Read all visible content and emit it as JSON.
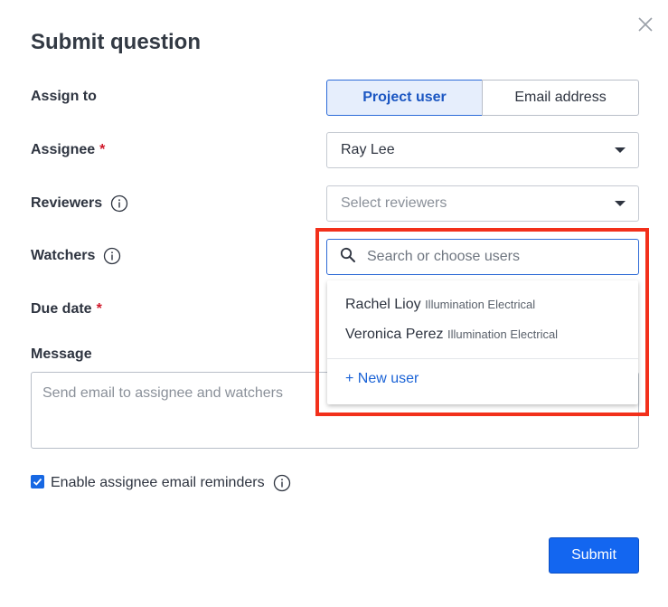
{
  "dialog": {
    "title": "Submit question",
    "close_icon": "close-icon"
  },
  "assign_to": {
    "label": "Assign to",
    "options": [
      "Project user",
      "Email address"
    ],
    "selected": "Project user"
  },
  "assignee": {
    "label": "Assignee",
    "required_mark": "*",
    "value": "Ray Lee"
  },
  "reviewers": {
    "label": "Reviewers",
    "placeholder": "Select reviewers"
  },
  "watchers": {
    "label": "Watchers",
    "search_placeholder": "Search or choose users",
    "options": [
      {
        "name": "Rachel Lioy",
        "company": "Illumination Electrical"
      },
      {
        "name": "Veronica Perez",
        "company": "Illumination Electrical"
      }
    ],
    "new_user_label": "+ New user"
  },
  "due_date": {
    "label": "Due date",
    "required_mark": "*"
  },
  "message": {
    "label": "Message",
    "placeholder": "Send email to assignee and watchers"
  },
  "reminders": {
    "checked": true,
    "label": "Enable assignee email reminders"
  },
  "actions": {
    "submit_label": "Submit"
  },
  "colors": {
    "primary": "#1366f0",
    "highlight": "#f2301b",
    "required": "#d0182a"
  }
}
